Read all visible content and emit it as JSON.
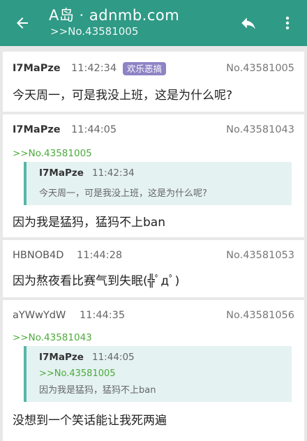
{
  "appbar": {
    "title": "A岛 · adnmb.com",
    "subtitle": ">>No.43581005",
    "back_icon": "arrow-left-icon",
    "reply_icon": "reply-icon",
    "more_icon": "more-vert-icon",
    "background": "#2f9a86"
  },
  "posts": [
    {
      "uid": "I7MaPze",
      "time": "11:42:34",
      "badge": "欢乐恶搞",
      "no": "No.43581005",
      "text": "今天周一，可是我没上班，这是为什么呢?"
    },
    {
      "uid": "I7MaPze",
      "time": "11:44:05",
      "no": "No.43581043",
      "ref": ">>No.43581005",
      "quote": {
        "uid": "I7MaPze",
        "time": "11:42:34",
        "text": "今天周一，可是我没上班，这是为什么呢?"
      },
      "text": "因为我是猛犸，猛犸不上ban"
    },
    {
      "uid": "HBNOB4D",
      "time": "11:44:28",
      "no": "No.43581053",
      "text": "因为熬夜看比赛气到失眠(╬ﾟдﾟ)"
    },
    {
      "uid": "aYWwYdW",
      "time": "11:44:35",
      "no": "No.43581056",
      "ref": ">>No.43581043",
      "quote": {
        "uid": "I7MaPze",
        "time": "11:44:05",
        "ref": ">>No.43581005",
        "text": "因为我是猛犸，猛犸不上ban"
      },
      "text": "没想到一个笑话能让我死两遍"
    }
  ]
}
